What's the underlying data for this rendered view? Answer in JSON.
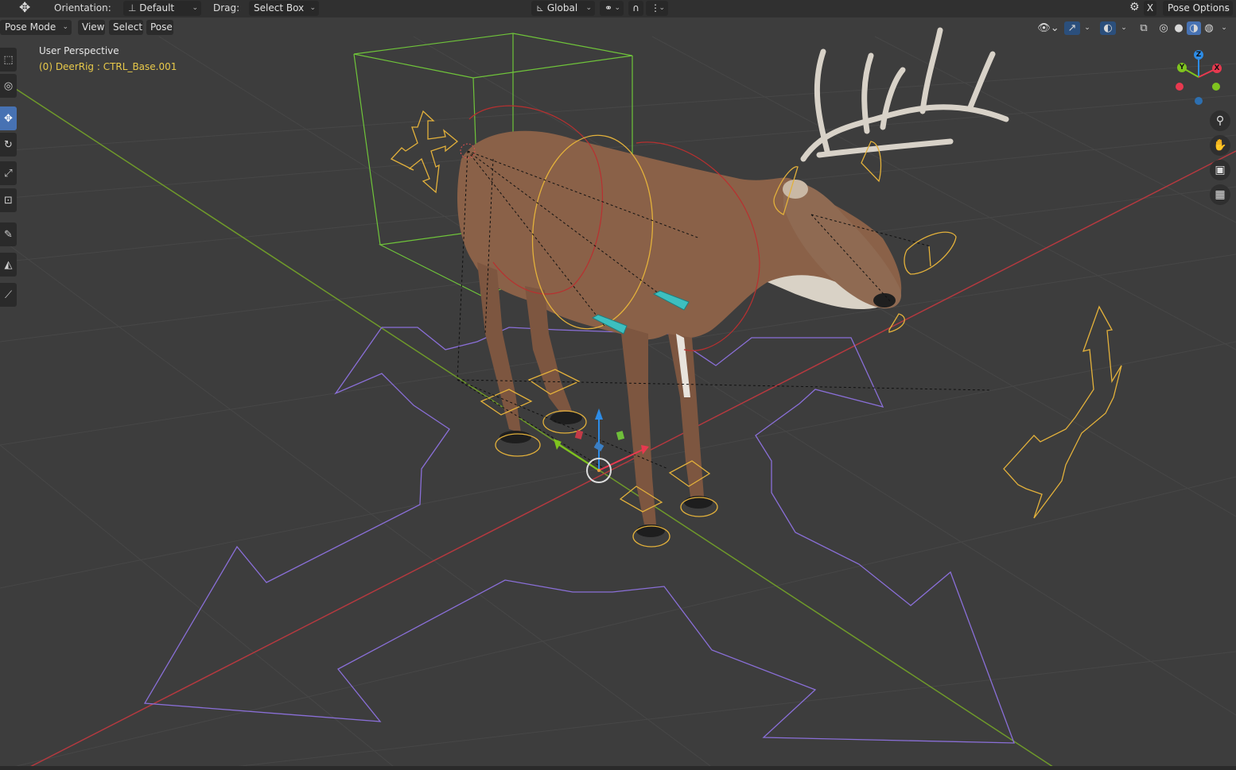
{
  "header": {
    "transform_icon": "move-arrows-icon",
    "orientation_label": "Orientation:",
    "orientation_value": "Default",
    "drag_label": "Drag:",
    "drag_value": "Select Box",
    "transform_space": "Global",
    "pose_options": "Pose Options",
    "close_x": "X"
  },
  "menu": {
    "mode": "Pose Mode",
    "items": [
      "View",
      "Select",
      "Pose"
    ]
  },
  "overlay": {
    "perspective": "User Perspective",
    "object_info": "(0) DeerRig : CTRL_Base.001"
  },
  "gizmo": {
    "axes": [
      "X",
      "Y",
      "Z"
    ],
    "colors": {
      "x": "#e8394f",
      "y": "#7fc41f",
      "z": "#2d8ce6"
    }
  },
  "tools": [
    "select-box-icon",
    "cursor-icon",
    "move-icon",
    "rotate-icon",
    "scale-icon",
    "transform-icon",
    "annotate-icon",
    "measure-icon",
    "ruler-icon"
  ],
  "nav_buttons": [
    "zoom-icon",
    "pan-hand-icon",
    "camera-icon",
    "grid-perspective-icon"
  ],
  "colors": {
    "background": "#3d3d3d",
    "grid": "#4a4a4a",
    "x_axis": "#b5393f",
    "y_axis": "#6f9a2a",
    "bone_shape": "#e3b13b",
    "root_shape": "#8a6fd8",
    "box_shape": "#6fc43a",
    "ik_red": "#b83030",
    "deer_body": "#8a6148",
    "active_tool": "#4772b3"
  }
}
